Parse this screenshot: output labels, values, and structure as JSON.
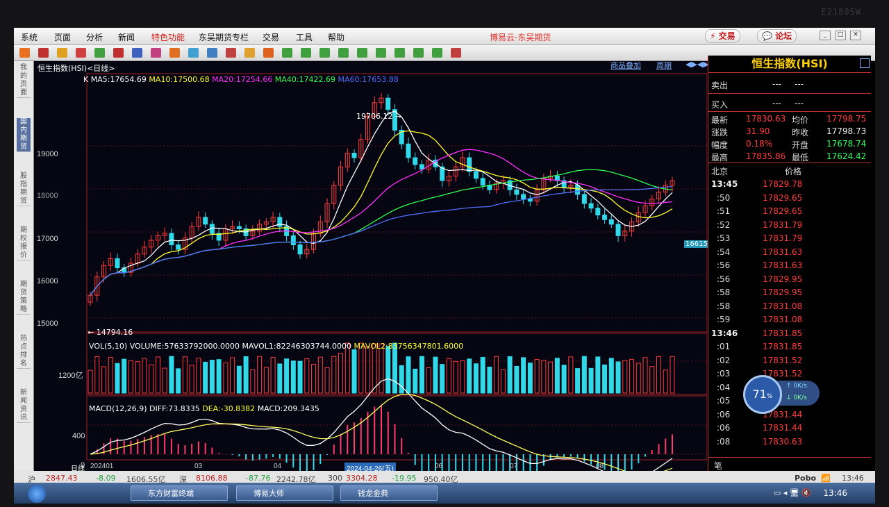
{
  "monitor": {
    "brand": "E2180SW"
  },
  "menu": {
    "items": [
      "系统",
      "页面",
      "分析",
      "新闻",
      "特色功能",
      "东吴期货专栏",
      "交易",
      "工具",
      "帮助"
    ],
    "app_title": "博易云-东吴期货",
    "trade_button": "交易",
    "forum_button": "论坛"
  },
  "chart": {
    "title": "恒生指数(HSI)<日线>",
    "top_links": {
      "overlay": "商品叠加",
      "period": "周期"
    },
    "ma_legend": [
      {
        "text": "K",
        "color": "#ffffff"
      },
      {
        "text": "MA5:17654.69",
        "color": "#ffffff"
      },
      {
        "text": "MA10:17500.68",
        "color": "#ffff30"
      },
      {
        "text": "MA20:17254.66",
        "color": "#ff30ff"
      },
      {
        "text": "MA40:17422.69",
        "color": "#30ff50"
      },
      {
        "text": "MA60:17653.88",
        "color": "#5070ff"
      }
    ],
    "price_ticks": [
      "19000",
      "18000",
      "17000",
      "16000",
      "15000"
    ],
    "high_label": "19706.12",
    "low_label": "14794.16",
    "cursor_price": "16615.14",
    "vol_legend": [
      {
        "text": "VOL(5,10) VOLUME:57633792000.0000",
        "color": "#ffffff"
      },
      {
        "text": "MAVOL1:82246303744.0000",
        "color": "#ffffff"
      },
      {
        "text": "MAVOL2:83756347801.6000",
        "color": "#ffff30"
      }
    ],
    "vol_tick": "1200亿",
    "macd_legend": [
      {
        "text": "MACD(12,26,9)",
        "color": "#ffffff"
      },
      {
        "text": "DIFF:73.8335",
        "color": "#ffffff"
      },
      {
        "text": "DEA:-30.8382",
        "color": "#ffff30"
      },
      {
        "text": "MACD:209.3435",
        "color": "#ffffff"
      }
    ],
    "macd_ticks": [
      "400",
      "0"
    ],
    "x_labels": [
      "日线",
      "202401",
      "03",
      "04",
      "2024-04-26(五)",
      "06",
      "07",
      "08"
    ]
  },
  "chart_data": {
    "type": "candlestick",
    "title": "恒生指数(HSI)<日线>",
    "period": "日线",
    "ylim": [
      14600,
      19900
    ],
    "annotations": {
      "high": 19706.12,
      "low": 14794.16,
      "cursor_price": 16615.14,
      "cursor_date": "2024-04-26(五)"
    },
    "close_series": [
      15400,
      15800,
      16050,
      16200,
      16000,
      15900,
      16100,
      16300,
      16450,
      16600,
      16700,
      16750,
      16500,
      16400,
      16650,
      16900,
      17100,
      16950,
      16750,
      16600,
      16850,
      16900,
      16850,
      16700,
      16800,
      16950,
      17000,
      17100,
      16900,
      16700,
      16500,
      16300,
      16400,
      16750,
      17000,
      17400,
      17800,
      18200,
      18500,
      18400,
      18800,
      19300,
      19600,
      19700,
      19450,
      19000,
      18700,
      18400,
      18250,
      18150,
      18350,
      18200,
      17900,
      18000,
      18200,
      18400,
      18100,
      17950,
      17800,
      17700,
      17850,
      17900,
      17700,
      17600,
      17500,
      17450,
      17700,
      17950,
      18000,
      17900,
      17750,
      17800,
      17600,
      17400,
      17300,
      17150,
      17050,
      16950,
      16700,
      16800,
      17000,
      17200,
      17350,
      17500,
      17650,
      17800,
      17900
    ],
    "ma_legend_values": {
      "MA5": 17654.69,
      "MA10": 17500.68,
      "MA20": 17254.66,
      "MA40": 17422.69,
      "MA60": 17653.88
    },
    "volume": {
      "VOLUME": 57633792000.0,
      "MAVOL1": 82246303744.0,
      "MAVOL2": 83756347801.6
    },
    "macd": {
      "DIFF": 73.8335,
      "DEA": -30.8382,
      "MACD": 209.3435
    }
  },
  "panel": {
    "title": "恒生指数(HSI)",
    "sell_label": "卖出",
    "sell_vals": [
      "---",
      "---"
    ],
    "buy_label": "买入",
    "buy_vals": [
      "---",
      "---"
    ],
    "quote": [
      {
        "l1": "最新",
        "v1": "17830.63",
        "l2": "均价",
        "v2": "17798.75",
        "c1": "red",
        "c2": "red"
      },
      {
        "l1": "涨跌",
        "v1": "31.90",
        "l2": "昨收",
        "v2": "17798.73",
        "c1": "red",
        "c2": "wht"
      },
      {
        "l1": "幅度",
        "v1": "0.18%",
        "l2": "开盘",
        "v2": "17678.74",
        "c1": "red",
        "c2": "grn"
      },
      {
        "l1": "最高",
        "v1": "17835.86",
        "l2": "最低",
        "v2": "17624.42",
        "c1": "red",
        "c2": "grn"
      }
    ],
    "tick_head": {
      "left": "北京",
      "right": "价格"
    },
    "ticks": [
      {
        "t": "13:45",
        "p": "17829.78"
      },
      {
        "t": ":50",
        "p": "17829.65"
      },
      {
        "t": ":51",
        "p": "17829.65"
      },
      {
        "t": ":52",
        "p": "17831.79"
      },
      {
        "t": ":53",
        "p": "17831.79"
      },
      {
        "t": ":54",
        "p": "17831.63"
      },
      {
        "t": ":56",
        "p": "17831.63"
      },
      {
        "t": ":56",
        "p": "17829.95"
      },
      {
        "t": ":58",
        "p": "17829.95"
      },
      {
        "t": ":58",
        "p": "17831.08"
      },
      {
        "t": ":59",
        "p": "17831.08"
      },
      {
        "t": "13:46",
        "p": "17831.85"
      },
      {
        "t": ":01",
        "p": "17831.85"
      },
      {
        "t": ":02",
        "p": "17831.52"
      },
      {
        "t": ":03",
        "p": "17831.52"
      },
      {
        "t": ":04",
        "p": "17831.52"
      },
      {
        "t": ":05",
        "p": "17831.52"
      },
      {
        "t": ":06",
        "p": "17831.44"
      },
      {
        "t": ":06",
        "p": "17831.44"
      },
      {
        "t": ":08",
        "p": "17830.63"
      }
    ],
    "footer_label": "笔"
  },
  "net_widget": {
    "percent": "71",
    "up": "0K/s",
    "down": "0K/s"
  },
  "status": {
    "sh_label": "沪",
    "sh_val": "2847.43",
    "sh_chg": "-8.09",
    "sh_amt": "1606.55亿",
    "sz_label": "深",
    "sz_val": "8106.88",
    "sz_chg": "-87.76",
    "sz_amt": "2242.78亿",
    "c3_label": "300",
    "c3_val": "3304.28",
    "c3_chg": "-19.95",
    "c3_amt": "950.40亿",
    "brand": "Pobo",
    "time": "13:46"
  },
  "taskbar": {
    "tasks": [
      "东方财富终端",
      "博易大师",
      "钱龙金典"
    ],
    "clock": "13:46"
  },
  "left_tabs": [
    "我的页面",
    "国内期货",
    "股指期货",
    "期权报价",
    "期货策略",
    "热点排名",
    "新闻资讯"
  ]
}
